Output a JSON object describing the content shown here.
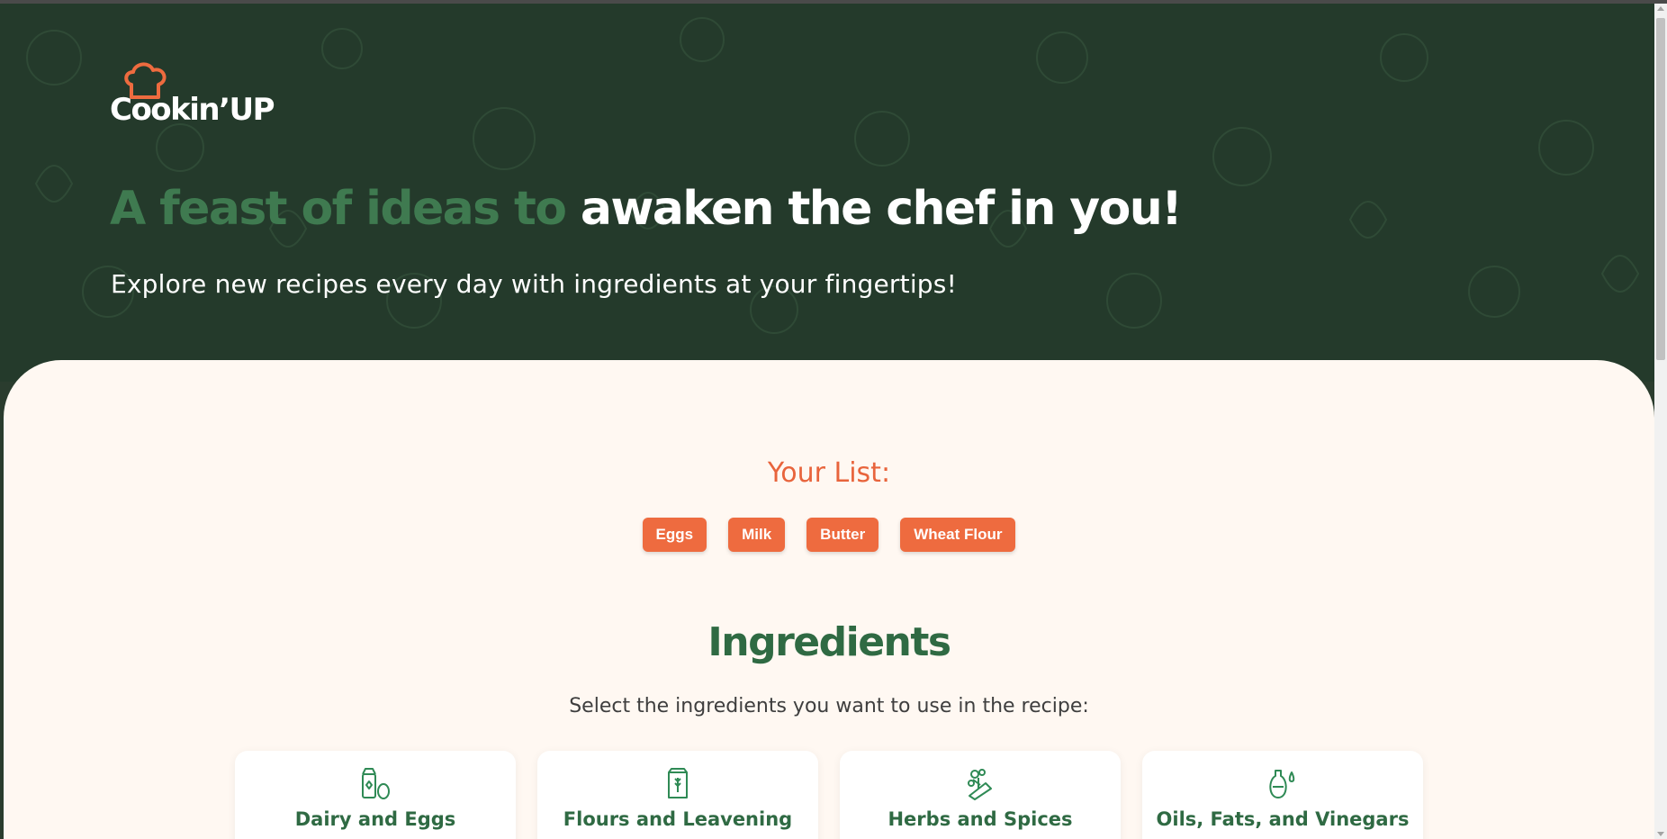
{
  "colors": {
    "hero_bg": "#243a2b",
    "headline_muted": "#3f7a50",
    "accent": "#ee6b3f",
    "list_title": "#e8643c",
    "ingredients_green": "#2f6a43",
    "content_bg": "#fff8f2"
  },
  "header": {
    "logo_text": "Cookin’UP",
    "logo_icon": "chef-hat-icon"
  },
  "hero": {
    "headline_muted": "A feast of ideas to ",
    "headline_bright": "awaken the chef in you!",
    "subline": "Explore new recipes every day with ingredients at your fingertips!"
  },
  "your_list": {
    "title": "Your List:",
    "items": [
      "Eggs",
      "Milk",
      "Butter",
      "Wheat Flour"
    ]
  },
  "ingredients": {
    "title": "Ingredients",
    "subtitle": "Select the ingredients you want to use in the recipe:",
    "categories": [
      {
        "label": "Dairy and Eggs",
        "icon": "milk-carton-egg-icon"
      },
      {
        "label": "Flours and Leavening",
        "icon": "flour-bag-icon"
      },
      {
        "label": "Herbs and Spices",
        "icon": "herbs-icon"
      },
      {
        "label": "Oils, Fats, and Vinegars",
        "icon": "oil-bottle-icon"
      }
    ]
  }
}
